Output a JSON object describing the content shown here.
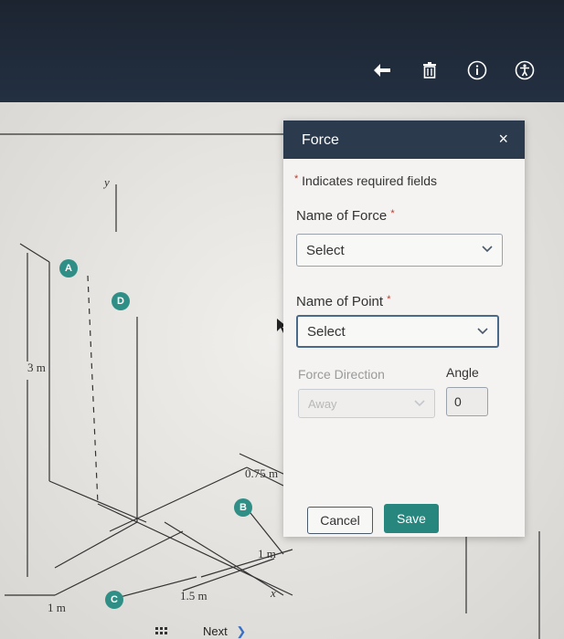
{
  "toolbar": {
    "icons": [
      "back-arrow-icon",
      "trash-icon",
      "info-icon",
      "accessibility-icon"
    ]
  },
  "diagram": {
    "labels": {
      "y_axis": "y",
      "x_axis": "x",
      "height": "3 m",
      "width_left": "1 m",
      "width_mid": "1.5 m",
      "offset_b": "0.75 m",
      "offset_bottom": "1 m"
    },
    "points": {
      "a": "A",
      "b": "B",
      "c": "C",
      "d": "D"
    }
  },
  "bottom_nav": {
    "next_label": "Next"
  },
  "dialog": {
    "title": "Force",
    "close_symbol": "×",
    "required_note": "Indicates required fields",
    "required_star": "*",
    "name_of_force_label": "Name of Force",
    "name_of_force_value": "Select",
    "name_of_point_label": "Name of Point",
    "name_of_point_value": "Select",
    "force_direction_label": "Force Direction",
    "force_direction_value": "Away",
    "angle_label": "Angle",
    "angle_value": "0",
    "cancel_label": "Cancel",
    "save_label": "Save"
  },
  "colors": {
    "accent_teal": "#27867d",
    "header_navy": "#2b3a4c",
    "required_red": "#c0392b"
  }
}
